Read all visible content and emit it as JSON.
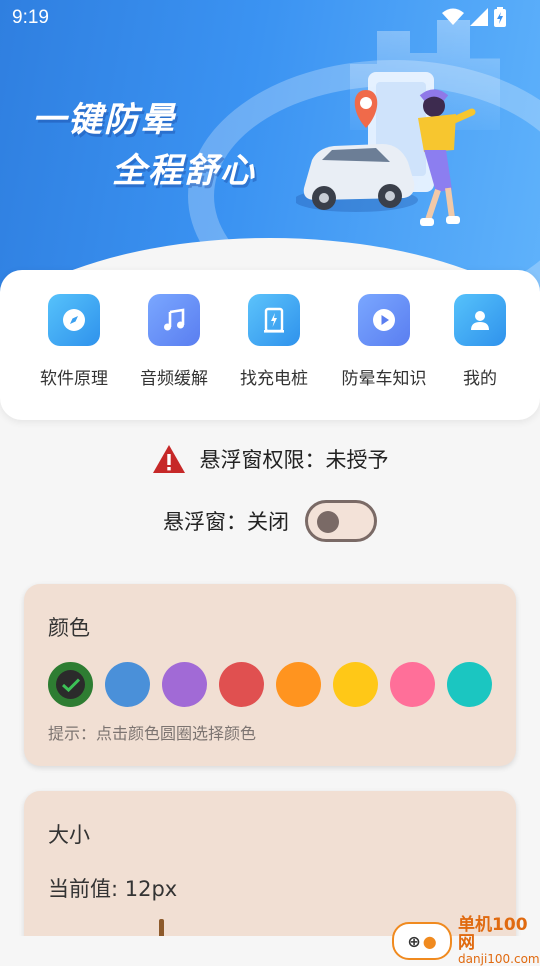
{
  "status_bar": {
    "time": "9:19"
  },
  "banner": {
    "line1": "一键防晕",
    "line2": "全程舒心"
  },
  "menu": [
    {
      "label": "软件原理",
      "icon": "compass-icon",
      "color": "#3aa8f5"
    },
    {
      "label": "音频缓解",
      "icon": "music-note-icon",
      "color": "#5b8ff0"
    },
    {
      "label": "找充电桩",
      "icon": "charging-pile-icon",
      "color": "#3ba6f4"
    },
    {
      "label": "防晕车知识",
      "icon": "play-icon",
      "color": "#5b8ff0"
    },
    {
      "label": "我的",
      "icon": "person-icon",
      "color": "#3aa8f5"
    }
  ],
  "permission": {
    "text": "悬浮窗权限：未授予"
  },
  "float_window": {
    "label": "悬浮窗：关闭",
    "enabled": false
  },
  "color_card": {
    "title": "颜色",
    "hint": "提示：点击颜色圆圈选择颜色",
    "swatches": [
      "#2e7d32",
      "#4a90d9",
      "#a16ad6",
      "#e05050",
      "#ff941f",
      "#ffc817",
      "#ff6f99",
      "#1bc6c1"
    ],
    "selected_index": 0
  },
  "size_card": {
    "title": "大小",
    "current": "当前值: 12px"
  },
  "watermark": {
    "title": "单机100网",
    "url": "danji100.com"
  }
}
